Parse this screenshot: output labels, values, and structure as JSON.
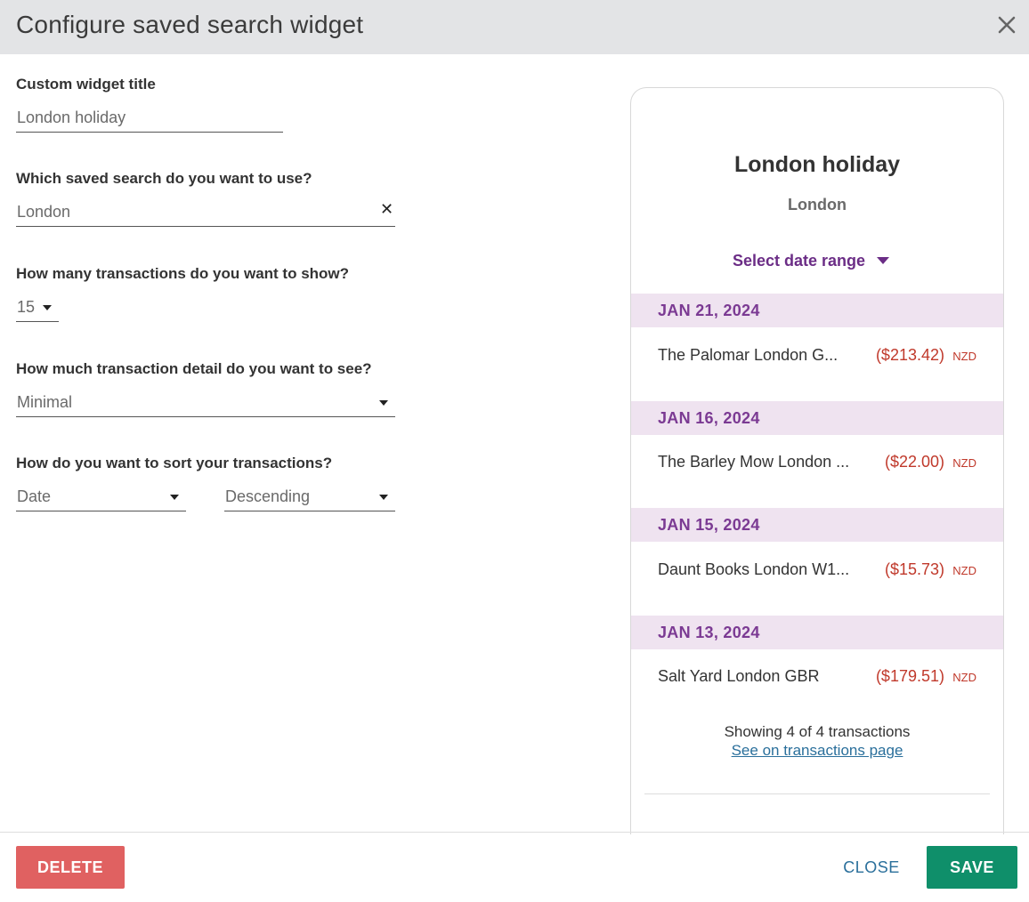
{
  "dialog": {
    "title": "Configure saved search widget",
    "close_icon": "close-icon"
  },
  "form": {
    "widget_title_label": "Custom widget title",
    "widget_title_value": "London holiday",
    "saved_search_label": "Which saved search do you want to use?",
    "saved_search_value": "London",
    "count_label": "How many transactions do you want to show?",
    "count_value": "15",
    "detail_label": "How much transaction detail do you want to see?",
    "detail_value": "Minimal",
    "sort_label": "How do you want to sort your transactions?",
    "sort_field_value": "Date",
    "sort_order_value": "Descending"
  },
  "preview": {
    "title": "London holiday",
    "subtitle": "London",
    "date_range_label": "Select date range",
    "groups": [
      {
        "date": "JAN 21, 2024",
        "name": "The Palomar London G...",
        "amount": "($213.42)",
        "currency": "NZD"
      },
      {
        "date": "JAN 16, 2024",
        "name": "The Barley Mow London ...",
        "amount": "($22.00)",
        "currency": "NZD"
      },
      {
        "date": "JAN 15, 2024",
        "name": "Daunt Books London W1...",
        "amount": "($15.73)",
        "currency": "NZD"
      },
      {
        "date": "JAN 13, 2024",
        "name": "Salt Yard London GBR",
        "amount": "($179.51)",
        "currency": "NZD"
      }
    ],
    "showing_text": "Showing 4 of 4 transactions",
    "link_text": "See on transactions page"
  },
  "footer": {
    "delete_label": "DELETE",
    "close_label": "CLOSE",
    "save_label": "SAVE"
  },
  "colors": {
    "header_bg": "#e3e4e6",
    "accent_purple": "#6b2d86",
    "date_header_bg": "#efe3f0",
    "amount_red": "#c0392b",
    "delete_red": "#e06161",
    "save_green": "#0f8f6a",
    "link_blue": "#2a6f9b"
  }
}
